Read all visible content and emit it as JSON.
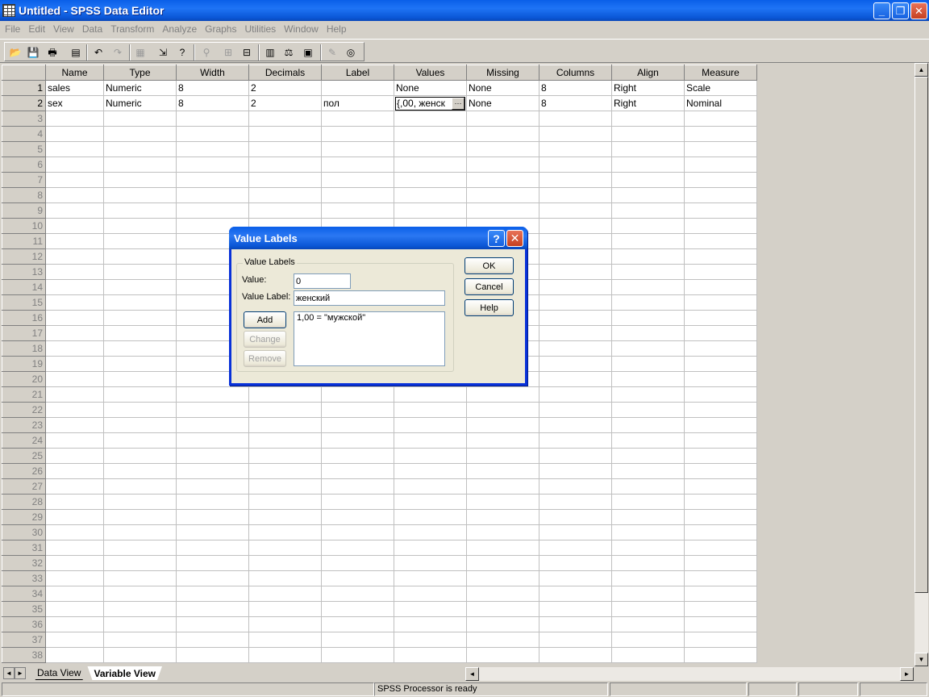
{
  "window": {
    "title": "Untitled - SPSS Data Editor",
    "min_glyph": "_",
    "max_glyph": "❐",
    "close_glyph": "✕"
  },
  "menu": [
    "File",
    "Edit",
    "View",
    "Data",
    "Transform",
    "Analyze",
    "Graphs",
    "Utilities",
    "Window",
    "Help"
  ],
  "toolbar": {
    "icons": [
      "open-icon",
      "save-icon",
      "print-icon",
      "dialog-recall-icon",
      "undo-icon",
      "redo-icon",
      "goto-chart-icon",
      "goto-case-icon",
      "variables-icon",
      "find-icon",
      "insert-case-icon",
      "insert-variable-icon",
      "split-file-icon",
      "weight-cases-icon",
      "select-cases-icon",
      "value-labels-icon",
      "use-sets-icon"
    ]
  },
  "grid": {
    "columns": [
      "Name",
      "Type",
      "Width",
      "Decimals",
      "Label",
      "Values",
      "Missing",
      "Columns",
      "Align",
      "Measure"
    ],
    "rows": [
      {
        "num": "1",
        "name": "sales",
        "type": "Numeric",
        "width": "8",
        "decimals": "2",
        "label": "",
        "values": "None",
        "missing": "None",
        "columns": "8",
        "align": "Right",
        "measure": "Scale"
      },
      {
        "num": "2",
        "name": "sex",
        "type": "Numeric",
        "width": "8",
        "decimals": "2",
        "label": "пол",
        "values": "{,00, женск",
        "missing": "None",
        "columns": "8",
        "align": "Right",
        "measure": "Nominal"
      }
    ],
    "empty_row_numbers": [
      "3",
      "4",
      "5",
      "6",
      "7",
      "8",
      "9",
      "10",
      "11",
      "12",
      "13",
      "14",
      "15",
      "16",
      "17",
      "18",
      "19",
      "20",
      "21",
      "22",
      "23",
      "24",
      "25",
      "26",
      "27",
      "28",
      "29",
      "30",
      "31",
      "32",
      "33",
      "34",
      "35",
      "36",
      "37",
      "38"
    ],
    "ellipsis": "···"
  },
  "tabs": {
    "data_view": "Data View",
    "variable_view": "Variable View",
    "active": "Variable View"
  },
  "status": {
    "processor": "SPSS Processor  is ready"
  },
  "dialog": {
    "title": "Value Labels",
    "help_glyph": "?",
    "close_glyph": "✕",
    "group_label": "Value Labels",
    "value_label": "Value:",
    "value_input": "0",
    "value_label_label": "Value Label:",
    "value_label_input": "женский",
    "list_items": [
      "1,00 = \"мужской\""
    ],
    "buttons": {
      "add": "Add",
      "change": "Change",
      "remove": "Remove",
      "ok": "OK",
      "cancel": "Cancel",
      "help": "Help"
    }
  }
}
